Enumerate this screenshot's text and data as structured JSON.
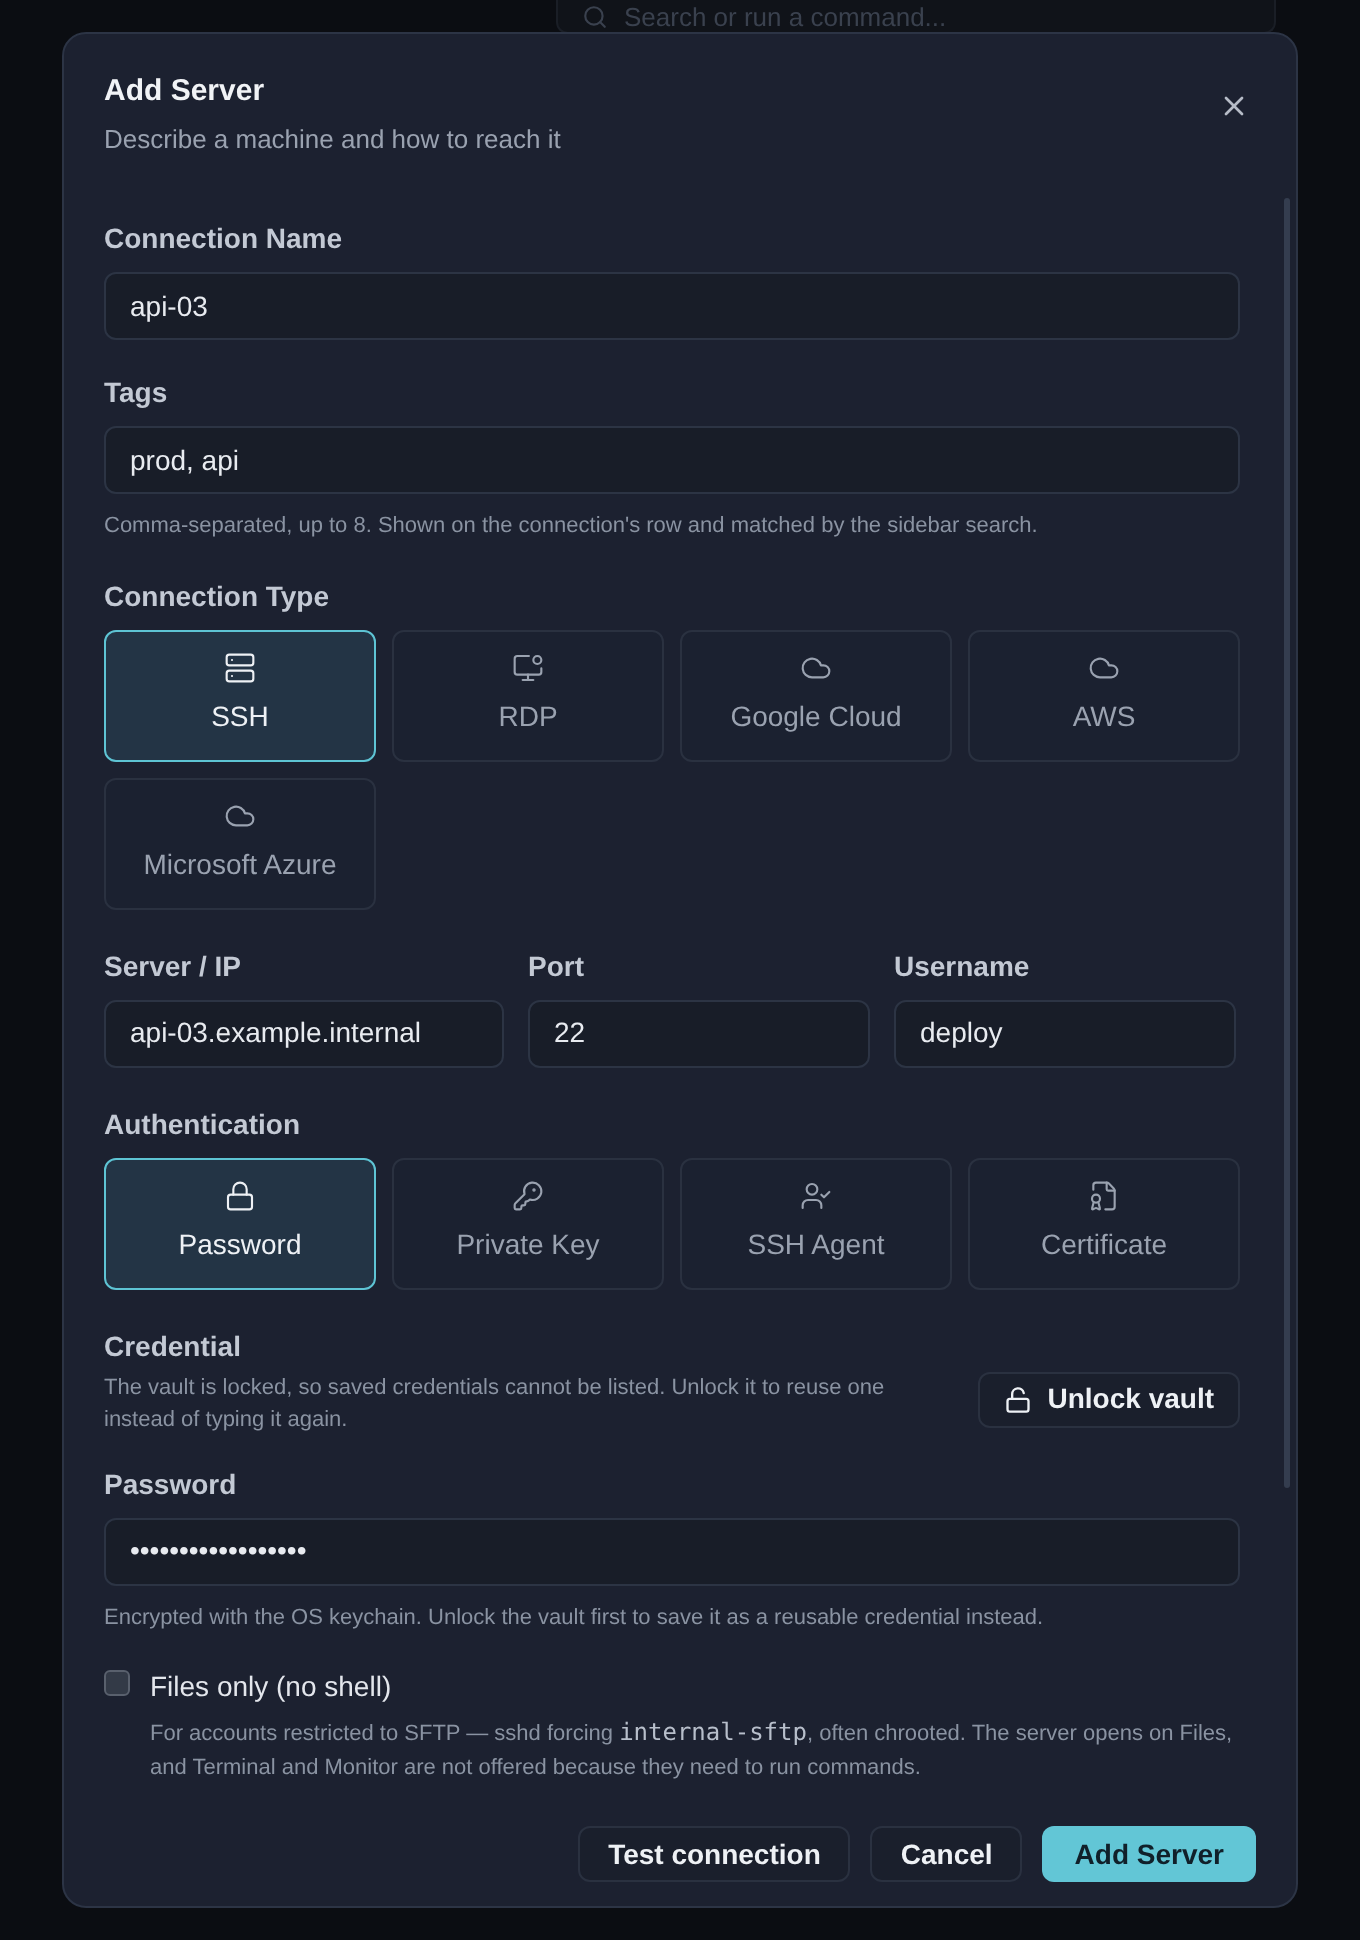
{
  "backdrop": {
    "search_placeholder": "Search or run a command..."
  },
  "dialog": {
    "title": "Add Server",
    "subtitle": "Describe a machine and how to reach it"
  },
  "connection_name": {
    "label": "Connection Name",
    "value": "api-03"
  },
  "tags": {
    "label": "Tags",
    "value": "prod, api",
    "hint": "Comma-separated, up to 8. Shown on the connection's row and matched by the sidebar search."
  },
  "connection_type": {
    "label": "Connection Type",
    "options": [
      {
        "label": "SSH",
        "selected": true
      },
      {
        "label": "RDP",
        "selected": false
      },
      {
        "label": "Google Cloud",
        "selected": false
      },
      {
        "label": "AWS",
        "selected": false
      },
      {
        "label": "Microsoft Azure",
        "selected": false
      }
    ]
  },
  "server": {
    "label": "Server / IP",
    "value": "api-03.example.internal"
  },
  "port": {
    "label": "Port",
    "value": "22"
  },
  "username": {
    "label": "Username",
    "value": "deploy"
  },
  "authentication": {
    "label": "Authentication",
    "options": [
      {
        "label": "Password",
        "selected": true
      },
      {
        "label": "Private Key",
        "selected": false
      },
      {
        "label": "SSH Agent",
        "selected": false
      },
      {
        "label": "Certificate",
        "selected": false
      }
    ]
  },
  "credential": {
    "label": "Credential",
    "text": "The vault is locked, so saved credentials cannot be listed. Unlock it to reuse one instead of typing it again.",
    "button": "Unlock vault"
  },
  "password": {
    "label": "Password",
    "value": "••••••••••••••••••",
    "hint": "Encrypted with the OS keychain. Unlock the vault first to save it as a reusable credential instead."
  },
  "files_only": {
    "label": "Files only (no shell)",
    "checked": false,
    "description": [
      {
        "kind": "text",
        "text": "For accounts restricted to SFTP — sshd forcing "
      },
      {
        "kind": "code",
        "text": "internal-sftp"
      },
      {
        "kind": "text",
        "text": ", often chrooted. The server opens on Files, and Terminal and Monitor are not offered because they need to run commands."
      }
    ]
  },
  "footer": {
    "buttons": [
      {
        "label": "Test connection",
        "kind": "secondary"
      },
      {
        "label": "Cancel",
        "kind": "secondary"
      },
      {
        "label": "Add Server",
        "kind": "primary"
      }
    ]
  }
}
